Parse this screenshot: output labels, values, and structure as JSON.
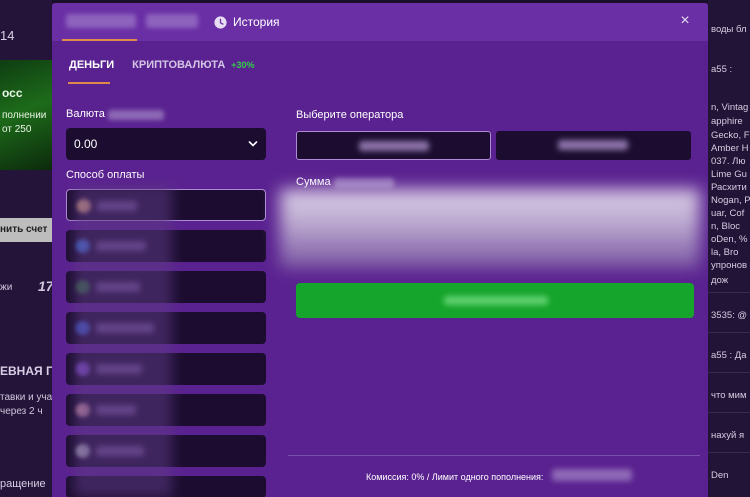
{
  "background": {
    "left": {
      "number_fragment": "14",
      "promo_title": "осс",
      "promo_line1": "полнении",
      "promo_line2": "от 250",
      "button_label": "нить счет",
      "small_text": "жи",
      "logo_fragment": "17",
      "heading": "ЕВНАЯ ГО",
      "line1": "тавки и уча",
      "line2": "через 2 ч",
      "bottom_text": "ращение"
    },
    "right": {
      "lines": [
        "воды бл",
        "a55 :",
        "n, Vintag",
        "apphire",
        "Gecko, F",
        "Amber H",
        "037. Лю",
        "Lime Gu",
        "Расхити",
        "Nogan, Р",
        "uar, Cof",
        "n, Bloc",
        "oDen, %",
        "la, Bro",
        "упронов",
        "дож",
        "3535: @",
        "a55 : Да",
        "что мим",
        "нахуй я",
        "Den"
      ]
    }
  },
  "modal": {
    "history_label": "История",
    "close_symbol": "×",
    "tabs": [
      {
        "label": "ДЕНЬГИ",
        "bonus": ""
      },
      {
        "label": "КРИПТОВАЛЮТА",
        "bonus": "+30%"
      }
    ],
    "currency": {
      "label": "Валюта",
      "value": "0.00"
    },
    "payment_method_label": "Способ оплаты",
    "operator_label": "Выберите оператора",
    "amount_label": "Сумма",
    "footer_text": "Комиссия: 0% / Лимит одного пополнения:"
  },
  "colors": {
    "modal_bg": "#5a2290",
    "topbar_bg": "#6a2fa5",
    "field_bg": "#1c0d30",
    "accent_orange": "#e08a4a",
    "bonus_green": "#35d04a",
    "submit_green": "#16a52c"
  },
  "icons": {
    "history": "clock-icon",
    "close": "close-icon",
    "dropdown": "chevron-down-icon"
  }
}
